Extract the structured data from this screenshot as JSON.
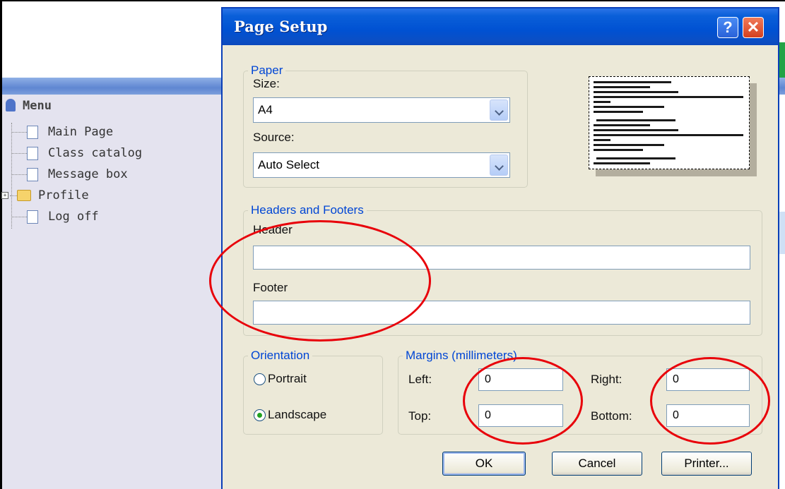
{
  "app_menu": {
    "title": "Menu",
    "items": [
      {
        "label": "Main Page",
        "icon": "document-icon"
      },
      {
        "label": "Class catalog",
        "icon": "document-icon"
      },
      {
        "label": "Message box",
        "icon": "document-icon"
      },
      {
        "label": "Profile",
        "icon": "folder-icon"
      },
      {
        "label": "Log off",
        "icon": "document-icon"
      }
    ]
  },
  "dialog": {
    "title": "Page Setup",
    "help_label": "?",
    "close_label": "✕",
    "paper": {
      "legend": "Paper",
      "size_label": "Size:",
      "size_value": "A4",
      "source_label": "Source:",
      "source_value": "Auto Select"
    },
    "headers_footers": {
      "legend": "Headers and Footers",
      "header_label": "Header",
      "header_value": "",
      "footer_label": "Footer",
      "footer_value": ""
    },
    "orientation": {
      "legend": "Orientation",
      "portrait_label": "Portrait",
      "landscape_label": "Landscape",
      "selected": "Landscape"
    },
    "margins": {
      "legend": "Margins (millimeters)",
      "left_label": "Left:",
      "left_value": "0",
      "right_label": "Right:",
      "right_value": "0",
      "top_label": "Top:",
      "top_value": "0",
      "bottom_label": "Bottom:",
      "bottom_value": "0"
    },
    "buttons": {
      "ok": "OK",
      "cancel": "Cancel",
      "printer": "Printer..."
    }
  },
  "colors": {
    "titlebar": "#0051d2",
    "legend_text": "#0046d5",
    "annotation": "#e8000a"
  }
}
